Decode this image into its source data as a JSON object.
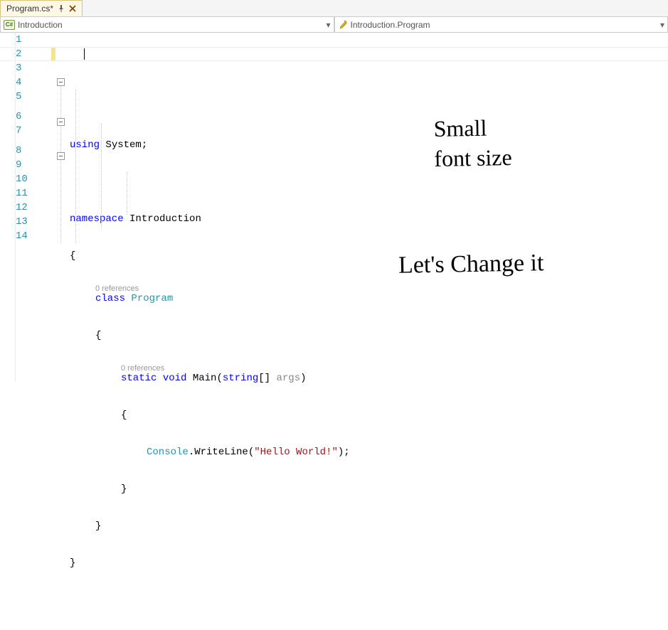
{
  "tab": {
    "title": "Program.cs*"
  },
  "nav": {
    "left": "Introduction",
    "right": "Introduction.Program"
  },
  "lines": [
    "1",
    "2",
    "3",
    "4",
    "5",
    "6",
    "7",
    "8",
    "9",
    "10",
    "11",
    "12",
    "13",
    "14"
  ],
  "codelens": "0 references",
  "code": {
    "l2_using": "using",
    "l2_system": " System;",
    "l4_ns": "namespace",
    "l4_name": " Introduction",
    "l5": "{",
    "l6_class": "class",
    "l6_name": " Program",
    "l7": "{",
    "l8_static": "static",
    "l8_void": " void",
    "l8_main": " Main(",
    "l8_string": "string",
    "l8_brackets": "[] ",
    "l8_args": "args",
    "l8_close": ")",
    "l9": "{",
    "l10_console": "Console",
    "l10_write": ".WriteLine(",
    "l10_str": "\"Hello World!\"",
    "l10_end": ");",
    "l11": "}",
    "l12": "}",
    "l13": "}"
  },
  "annotation": {
    "line1": "Small",
    "line2": "font size",
    "line3": "Let's Change it"
  }
}
